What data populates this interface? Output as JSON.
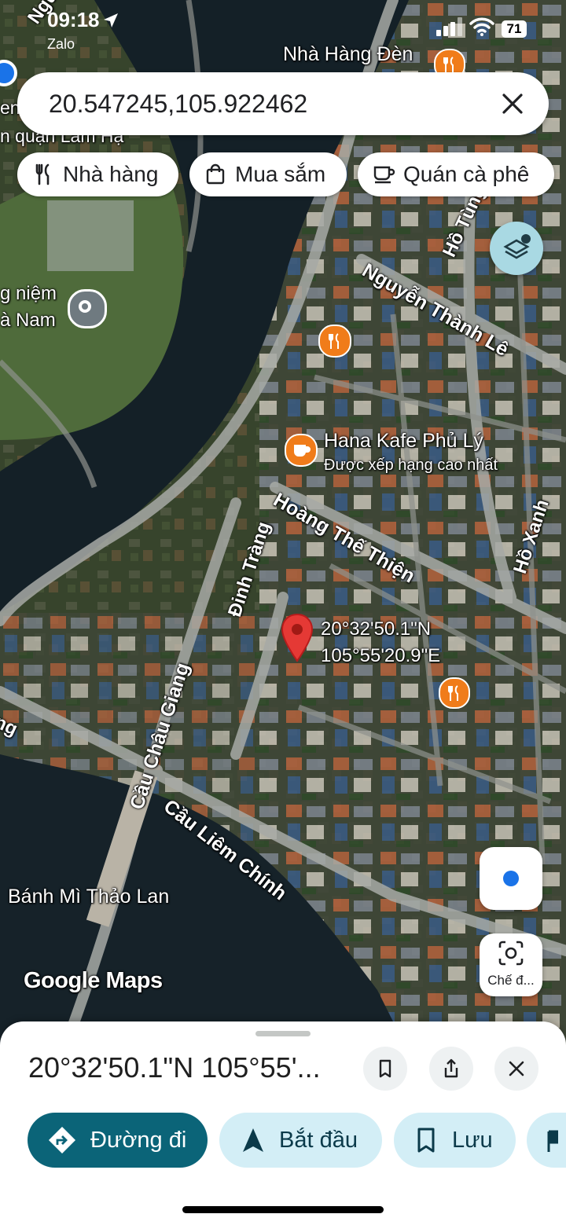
{
  "status_bar": {
    "time": "09:18",
    "back_app": "Zalo",
    "battery": "71"
  },
  "search": {
    "query": "20.547245,105.922462"
  },
  "chips": [
    {
      "label": "Nhà hàng",
      "icon": "restaurant-icon"
    },
    {
      "label": "Mua sắm",
      "icon": "shopping-bag-icon"
    },
    {
      "label": "Quán cà phê",
      "icon": "coffee-icon"
    }
  ],
  "map": {
    "streets": {
      "nguyen_top": "Nguyễn",
      "nguyen_thanh_le": "Nguyễn Thành Lê",
      "ho_tung": "Hồ Tùng",
      "hoang_the_thien": "Hoàng Thế Thiện",
      "dinh_trang": "Đinh Tràng",
      "cau_chau_giang": "Cầu Châu Giang",
      "cau_liem_chinh": "Cầu Liêm Chính",
      "ho_xanh": "Hồ Xanh",
      "left_edge_ng": "ng",
      "lam_ha": "n quận Lâm Hạ",
      "top_left_en": "en"
    },
    "pois": {
      "nha_hang_den": "Nhà Hàng Đèn",
      "niem_line1": "g niệm",
      "niem_line2": "à Nam",
      "hana_name": "Hana Kafe Phủ Lý",
      "hana_sub": "Được xếp hạng cao nhất",
      "banh_mi": "Bánh Mì Thảo Lan"
    },
    "pin": {
      "lat": "20°32'50.1\"N",
      "lng": "105°55'20.9\"E"
    },
    "logo": "Google Maps",
    "camera_label": "Chế đ..."
  },
  "sheet": {
    "title": "20°32'50.1\"N 105°55'...",
    "actions": {
      "directions": "Đường đi",
      "start": "Bắt đầu",
      "save": "Lưu"
    }
  }
}
